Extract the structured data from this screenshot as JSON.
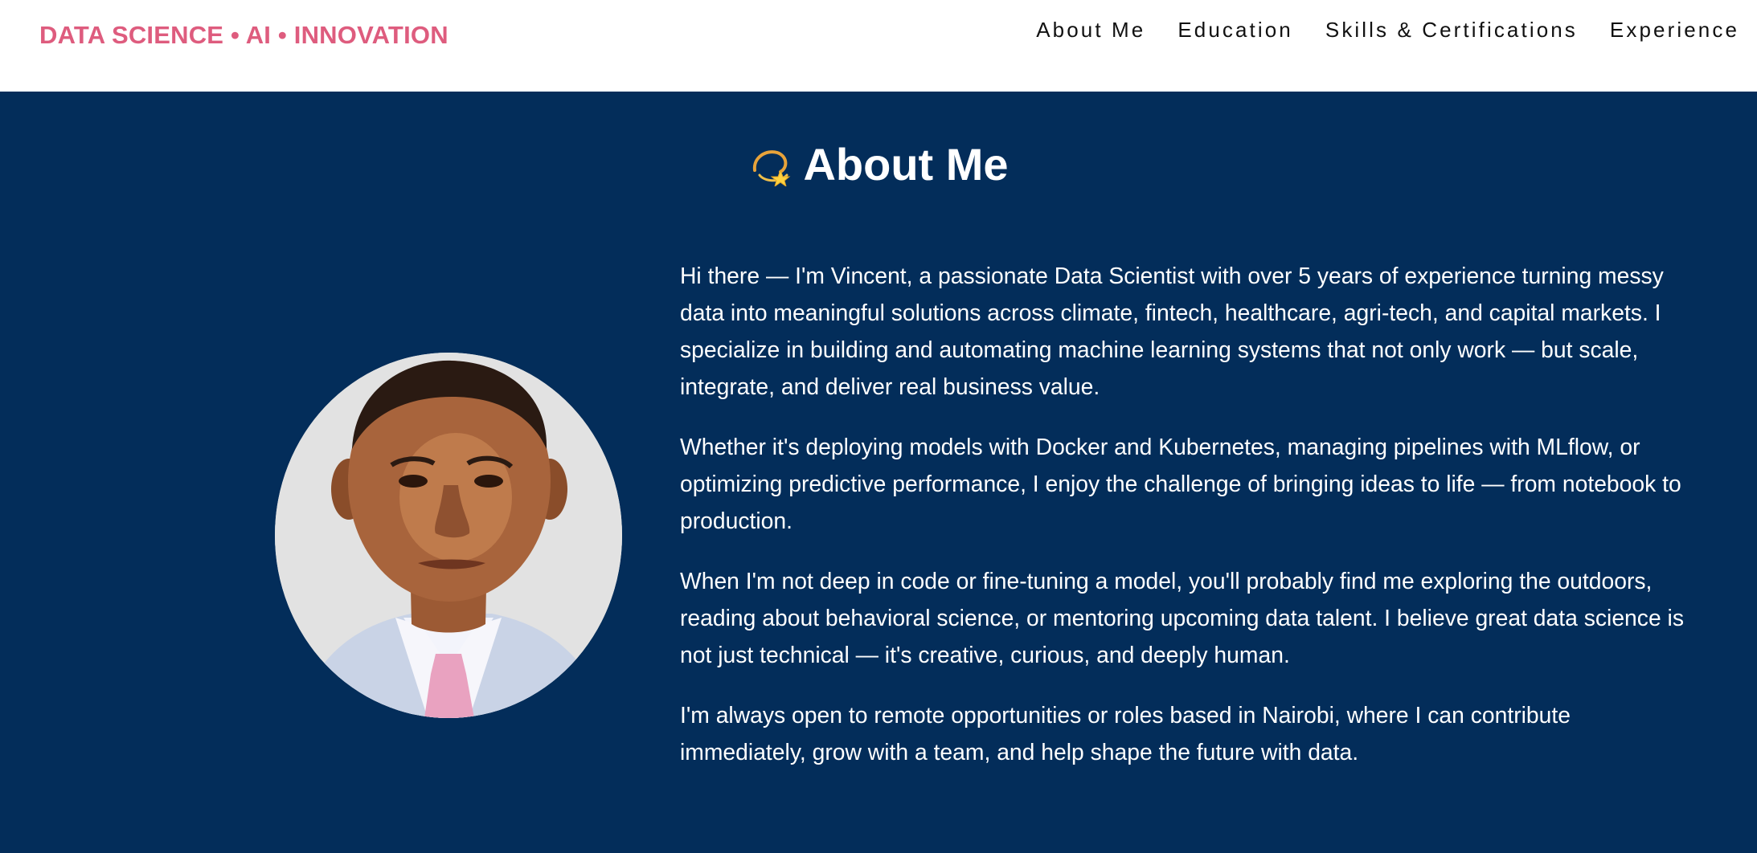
{
  "header": {
    "brand": "DATA SCIENCE • AI • INNOVATION",
    "nav": [
      {
        "label": "About Me"
      },
      {
        "label": "Education"
      },
      {
        "label": "Skills & Certifications"
      },
      {
        "label": "Experience"
      }
    ]
  },
  "about": {
    "icon": "dizzy-icon",
    "title": "About Me",
    "paragraphs": [
      "Hi there — I'm Vincent, a passionate Data Scientist with over 5 years of experience turning messy data into meaningful solutions across climate, fintech, healthcare, agri-tech, and capital markets. I specialize in building and automating machine learning systems that not only work — but scale, integrate, and deliver real business value.",
      "Whether it's deploying models with Docker and Kubernetes, managing pipelines with MLflow, or optimizing predictive performance, I enjoy the challenge of bringing ideas to life — from notebook to production.",
      "When I'm not deep in code or fine-tuning a model, you'll probably find me exploring the outdoors, reading about behavioral science, or mentoring upcoming data talent. I believe great data science is not just technical — it's creative, curious, and deeply human.",
      "I'm always open to remote opportunities or roles based in Nairobi, where I can contribute immediately, grow with a team, and help shape the future with data."
    ]
  },
  "colors": {
    "brand": "#de5c7e",
    "section_background": "#032d5a",
    "text_light": "#ffffff",
    "nav_text": "#111111"
  }
}
